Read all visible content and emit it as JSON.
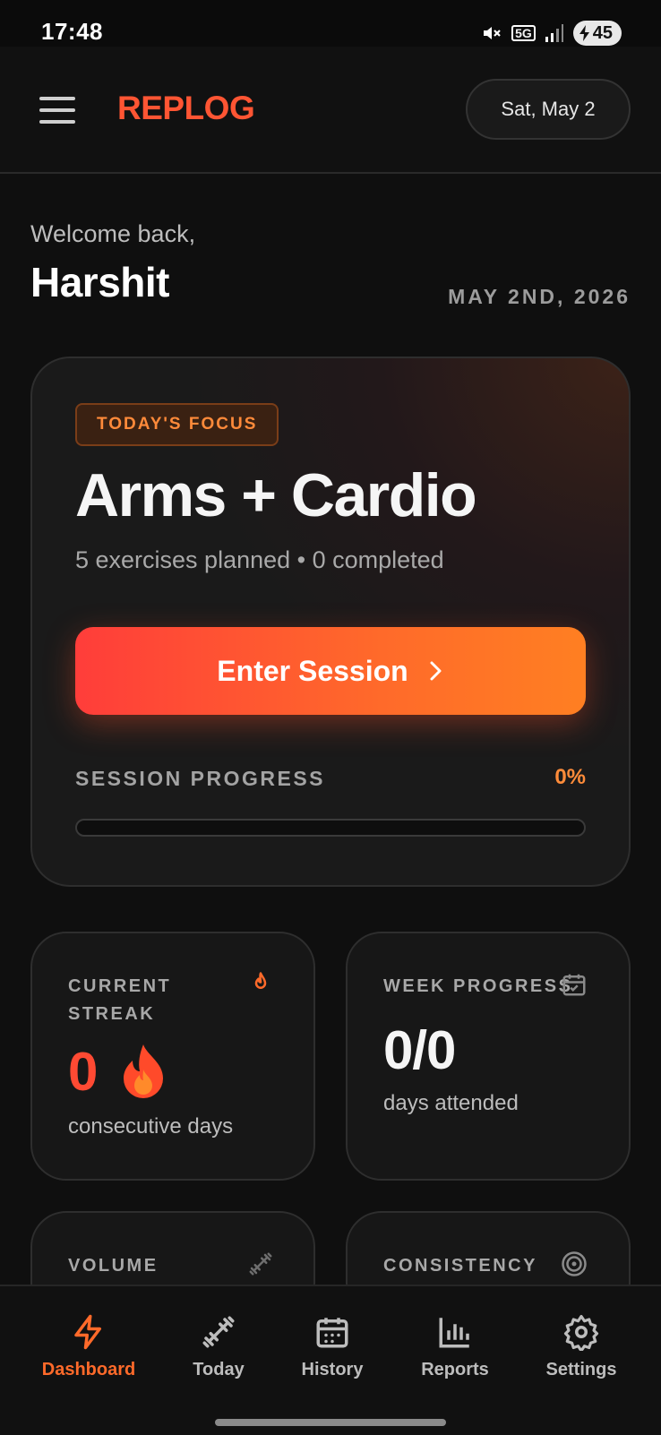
{
  "status_bar": {
    "time": "17:48",
    "network": "5G",
    "battery": "45"
  },
  "header": {
    "logo": "REPLOG",
    "date_pill": "Sat, May 2"
  },
  "welcome": {
    "greeting": "Welcome back,",
    "name": "Harshit",
    "date": "MAY 2ND, 2026"
  },
  "focus": {
    "badge": "TODAY'S FOCUS",
    "title": "Arms + Cardio",
    "subtitle": "5 exercises planned • 0 completed",
    "button": "Enter Session",
    "progress_label": "SESSION PROGRESS",
    "progress_value": "0%",
    "progress_fraction": 0
  },
  "stats": {
    "streak": {
      "label": "CURRENT STREAK",
      "value": "0",
      "caption": "consecutive days",
      "icon": "flame-icon"
    },
    "week": {
      "label": "WEEK PROGRESS",
      "value": "0/0",
      "caption": "days attended",
      "icon": "calendar-check-icon"
    },
    "volume": {
      "label": "VOLUME",
      "icon": "dumbbell-icon"
    },
    "consistency": {
      "label": "CONSISTENCY",
      "icon": "target-icon"
    }
  },
  "nav": [
    {
      "label": "Dashboard",
      "icon": "lightning-icon",
      "active": true
    },
    {
      "label": "Today",
      "icon": "dumbbell-icon",
      "active": false
    },
    {
      "label": "History",
      "icon": "calendar-icon",
      "active": false
    },
    {
      "label": "Reports",
      "icon": "bar-chart-icon",
      "active": false
    },
    {
      "label": "Settings",
      "icon": "gear-icon",
      "active": false
    }
  ],
  "colors": {
    "accent": "#ff5533",
    "accent_orange": "#ff8c3a",
    "background": "#0f0f0f",
    "card": "#171717"
  }
}
